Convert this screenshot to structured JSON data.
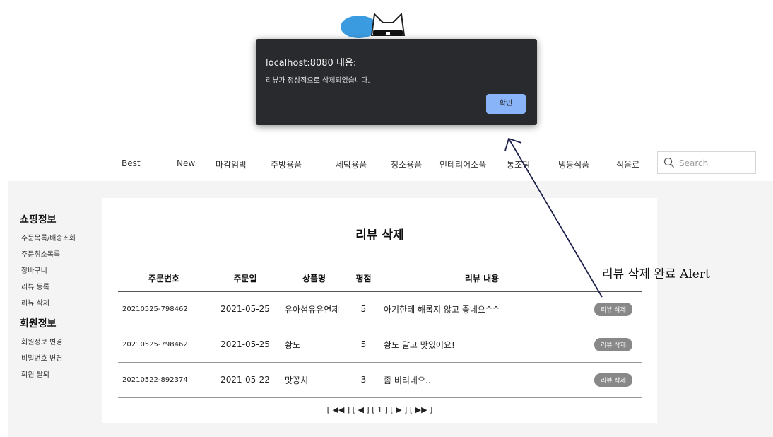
{
  "nav": {
    "items": [
      "Best",
      "New",
      "마감임박",
      "주방용품",
      "세탁용품",
      "청소용품",
      "인테리어소품",
      "통조림",
      "냉동식품",
      "식음료"
    ],
    "search_placeholder": "Search"
  },
  "sidebar": {
    "groups": [
      {
        "heading": "쇼핑정보",
        "items": [
          "주문목록/배송조회",
          "주문취소목록",
          "장바구니",
          "리뷰 등록",
          "리뷰 삭제"
        ]
      },
      {
        "heading": "회원정보",
        "items": [
          "회원정보 변경",
          "비밀번호 변경",
          "회원 탈퇴"
        ]
      }
    ]
  },
  "main": {
    "title": "리뷰 삭제",
    "table": {
      "headers": [
        "주문번호",
        "주문일",
        "상품명",
        "평점",
        "리뷰 내용",
        ""
      ],
      "rows": [
        {
          "order_no": "20210525-798462",
          "date": "2021-05-25",
          "product": "유아섬유유연제",
          "rating": "5",
          "content": "아기한테 해롭지 않고 좋네요^^",
          "action": "리뷰 삭제"
        },
        {
          "order_no": "20210525-798462",
          "date": "2021-05-25",
          "product": "황도",
          "rating": "5",
          "content": "황도 달고 맛있어요!",
          "action": "리뷰 삭제"
        },
        {
          "order_no": "20210522-892374",
          "date": "2021-05-22",
          "product": "맛꽁치",
          "rating": "3",
          "content": "좀 비리네요..",
          "action": "리뷰 삭제"
        }
      ]
    },
    "pagination": {
      "first": "[ ◀◀ ]",
      "prev": "[ ◀ ]",
      "current": "[ 1 ]",
      "next": "[ ▶ ]",
      "last": "[ ▶▶ ]"
    }
  },
  "alert": {
    "title": "localhost:8080 내용:",
    "message": "리뷰가 정상적으로 삭제되었습니다.",
    "ok_label": "확인"
  },
  "annotation": {
    "text": "리뷰 삭제 완료 Alert"
  },
  "colors": {
    "alert_bg": "#292a2d",
    "ok_button": "#8ab4f8",
    "delete_button": "#888888",
    "content_bg": "#f4f4f4"
  }
}
